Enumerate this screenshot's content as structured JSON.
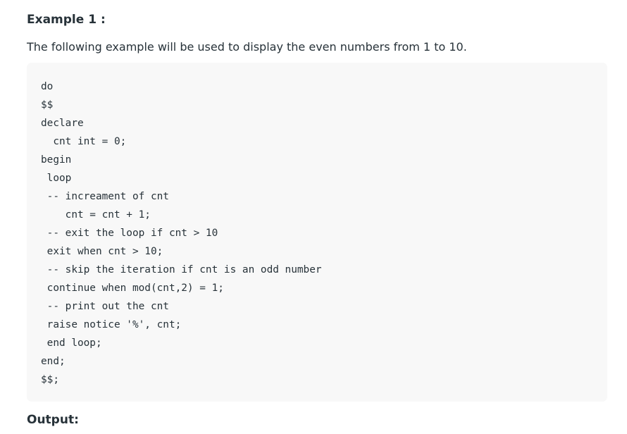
{
  "example": {
    "heading": "Example 1 :",
    "description": "The following example will be used to display the even numbers from 1 to 10."
  },
  "code": {
    "lines": [
      "do",
      "$$",
      "declare",
      "  cnt int = 0;",
      "begin",
      " loop",
      " -- increament of cnt",
      "    cnt = cnt + 1;",
      " -- exit the loop if cnt > 10",
      " exit when cnt > 10;",
      " -- skip the iteration if cnt is an odd number",
      " continue when mod(cnt,2) = 1;",
      " -- print out the cnt",
      " raise notice '%', cnt;",
      " end loop;",
      "end;",
      "$$;"
    ]
  },
  "output": {
    "heading": "Output:"
  }
}
